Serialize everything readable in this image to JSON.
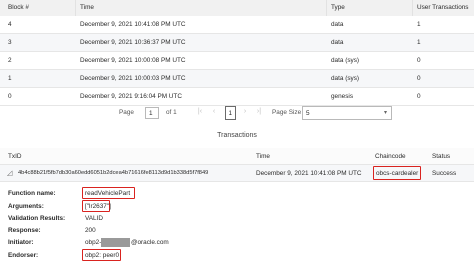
{
  "blocks_table": {
    "headers": {
      "block": "Block #",
      "time": "Time",
      "type": "Type",
      "user_tx": "User Transactions"
    },
    "rows": [
      {
        "block": "4",
        "time": "December 9, 2021 10:41:08 PM UTC",
        "type": "data",
        "user_tx": "1"
      },
      {
        "block": "3",
        "time": "December 9, 2021 10:36:37 PM UTC",
        "type": "data",
        "user_tx": "1"
      },
      {
        "block": "2",
        "time": "December 9, 2021 10:00:08 PM UTC",
        "type": "data (sys)",
        "user_tx": "0"
      },
      {
        "block": "1",
        "time": "December 9, 2021 10:00:03 PM UTC",
        "type": "data (sys)",
        "user_tx": "0"
      },
      {
        "block": "0",
        "time": "December 9, 2021 9:16:04 PM UTC",
        "type": "genesis",
        "user_tx": "0"
      }
    ]
  },
  "pagination": {
    "page_label": "Page",
    "page_value": "1",
    "of_label": "of 1",
    "current_page": "1",
    "page_size_label": "Page Size",
    "page_size_value": "5"
  },
  "transactions": {
    "title": "Transactions",
    "headers": {
      "txid": "TxID",
      "time": "Time",
      "chaincode": "Chaincode",
      "status": "Status"
    },
    "row": {
      "txid": "4b4c88b21f5fb7db30a60edd6051b2dcea4b71616fe8113d9d1b338d5f7f849",
      "time": "December 9, 2021 10:41:08 PM UTC",
      "chaincode": "obcs-cardealer",
      "status": "Success"
    }
  },
  "details": {
    "function_name_label": "Function name:",
    "function_name_value": "readVehiclePart",
    "arguments_label": "Arguments:",
    "arguments_value": "[\"lr2637\"]",
    "validation_label": "Validation Results:",
    "validation_value": "VALID",
    "response_label": "Response:",
    "response_value": "200",
    "initiator_label": "Initiator:",
    "initiator_prefix": "obp2-",
    "initiator_suffix": "@oracle.com",
    "endorser_label": "Endorser:",
    "endorser_value": "obp2: peer0"
  },
  "colors": {
    "highlight": "#d9231f",
    "header_bg": "#f1f1f1",
    "row_shade": "#f6f7f9"
  }
}
